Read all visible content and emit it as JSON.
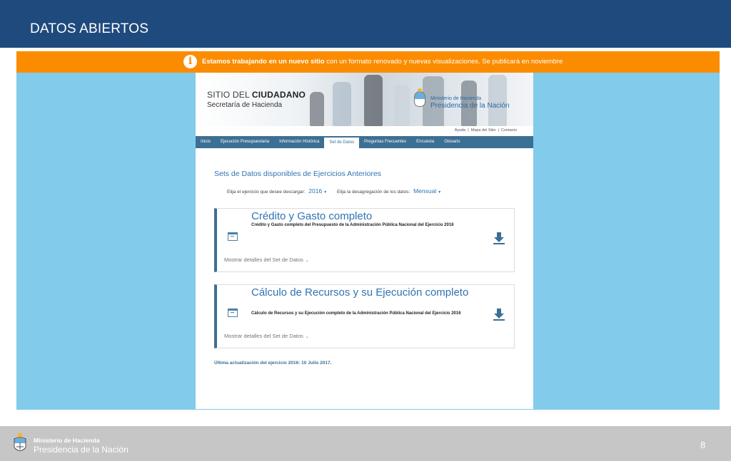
{
  "slide": {
    "title": "DATOS ABIERTOS",
    "page_number": "8"
  },
  "notice": {
    "bold_text": "Estamos trabajando en un nuevo sitio",
    "rest_text": " con un formato renovado y nuevas visualizaciones. Se publicará en noviembre",
    "icon_glyph": "i"
  },
  "site": {
    "title_light": "SITIO DEL ",
    "title_bold": "CIUDADANO",
    "subtitle": "Secretaría de Hacienda",
    "ministry": "Ministerio de Hacienda",
    "presidency": "Presidencia de la Nación",
    "util_links": [
      "Ayuda",
      "Mapa del Sitio",
      "Contacto"
    ],
    "nav_tabs": [
      {
        "label": "Inicio",
        "active": false
      },
      {
        "label": "Ejecución Presupuestaria",
        "active": false
      },
      {
        "label": "Información Histórica",
        "active": false
      },
      {
        "label": "Set de Datos",
        "active": true
      },
      {
        "label": "Preguntas Frecuentes",
        "active": false
      },
      {
        "label": "Encuesta",
        "active": false
      },
      {
        "label": "Glosario",
        "active": false
      }
    ],
    "heading": "Sets de Datos disponibles de Ejercicios Anteriores",
    "filter_year_label": "Elija el ejercicio que desee descargar:",
    "filter_year_value": "2016",
    "filter_breakdown_label": "Elija la desagregación de los datos:",
    "filter_breakdown_value": "Mensual",
    "datasets": [
      {
        "title": "Crédito y Gasto completo",
        "description": "Crédito y Gasto completo del Presupuesto de la Administración Pública Nacional del Ejercicio 2016",
        "details_label": "Mostrar detalles del Set de Datos"
      },
      {
        "title": "Cálculo de Recursos y su Ejecución completo",
        "description": "Cálculo de Recursos y su Ejecución completo de la Administración Pública Nacional del Ejercicio 2016",
        "details_label": "Mostrar detalles del Set de Datos"
      }
    ],
    "last_update": "Última actualización del ejercicio 2016: 10 Julio 2017."
  },
  "footer": {
    "ministry": "Ministerio de Hacienda",
    "presidency": "Presidencia de la Nación"
  },
  "icons": {
    "notice": "info-icon",
    "calendar": "calendar-icon",
    "download": "download-icon",
    "chevron": "chevron-down-icon",
    "caret": "caret-down-icon"
  },
  "colors": {
    "top_bar": "#1f4a7d",
    "notice": "#fb8c00",
    "background_blue": "#82cbea",
    "nav": "#3c6f94",
    "link_blue": "#2f73b3",
    "footer": "#c6c6c6"
  }
}
